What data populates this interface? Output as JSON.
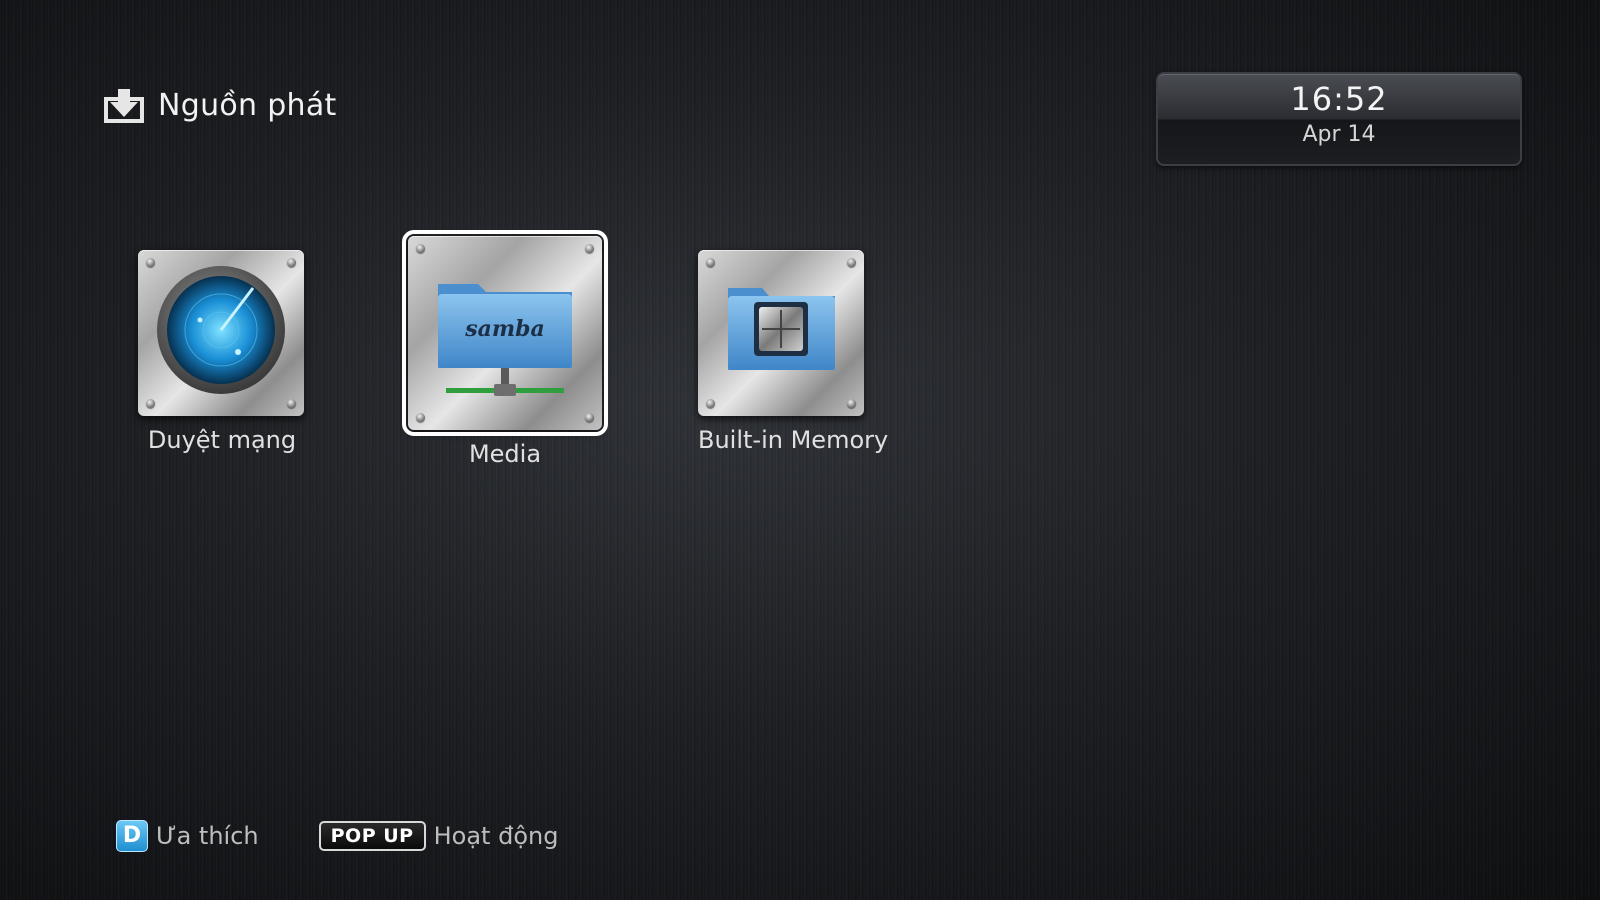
{
  "header": {
    "title": "Nguồn phát",
    "icon": "download-tray-icon"
  },
  "clock": {
    "time": "16:52",
    "date": "Apr 14"
  },
  "tiles": [
    {
      "label": "Duyệt mạng",
      "icon": "radar-icon",
      "selected": false
    },
    {
      "label": "Media",
      "icon": "samba-network-folder-icon",
      "icon_text": "samba",
      "selected": true
    },
    {
      "label": "Built-in Memory",
      "icon": "memory-chip-folder-icon",
      "selected": false
    }
  ],
  "footer": {
    "favorites": {
      "key": "D",
      "label": "Ưa thích",
      "key_color": "#1f8ed0"
    },
    "activity": {
      "key": "POP UP",
      "label": "Hoạt động"
    }
  }
}
